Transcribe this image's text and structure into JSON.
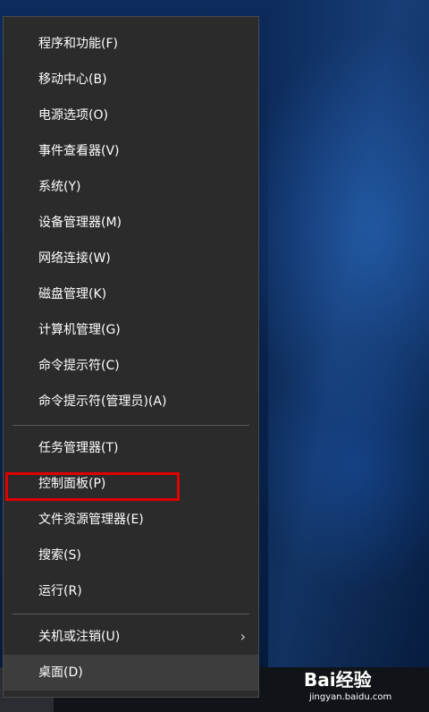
{
  "menu": {
    "items": [
      {
        "label": "程序和功能(F)"
      },
      {
        "label": "移动中心(B)"
      },
      {
        "label": "电源选项(O)"
      },
      {
        "label": "事件查看器(V)"
      },
      {
        "label": "系统(Y)"
      },
      {
        "label": "设备管理器(M)"
      },
      {
        "label": "网络连接(W)"
      },
      {
        "label": "磁盘管理(K)"
      },
      {
        "label": "计算机管理(G)"
      },
      {
        "label": "命令提示符(C)"
      },
      {
        "label": "命令提示符(管理员)(A)"
      },
      {
        "label": "任务管理器(T)"
      },
      {
        "label": "控制面板(P)"
      },
      {
        "label": "文件资源管理器(E)"
      },
      {
        "label": "搜索(S)"
      },
      {
        "label": "运行(R)"
      },
      {
        "label": "关机或注销(U)",
        "submenu_icon": "chevron-right-icon"
      },
      {
        "label": "桌面(D)"
      }
    ]
  },
  "watermark": {
    "logo_text": "Bai经验",
    "url": "jingyan.baidu.com"
  },
  "colors": {
    "menu_background": "#2b2b2b",
    "highlight_border": "#e00000",
    "text": "#ffffff"
  }
}
